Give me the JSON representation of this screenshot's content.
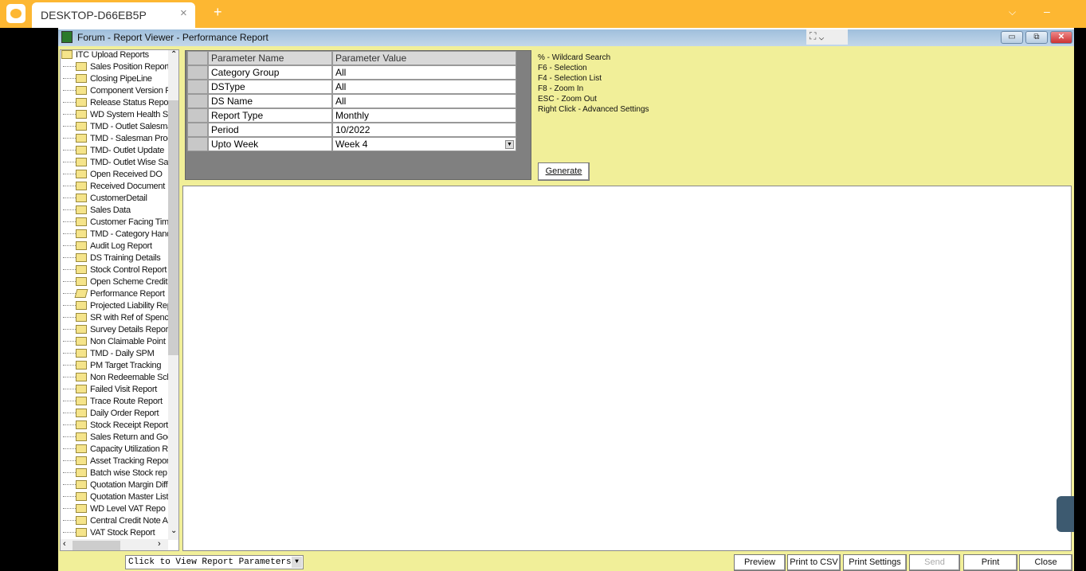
{
  "browser": {
    "tab_title": "DESKTOP-D66EB5P",
    "close": "×",
    "new_tab": "+",
    "chevron": "⌵",
    "minimize": "–"
  },
  "window": {
    "title": "Forum - Report Viewer - Performance Report",
    "min": "▭",
    "restore": "⧉",
    "close": "✕",
    "grip": "⛶ ⌄"
  },
  "tree": {
    "root": "ITC Upload Reports",
    "items": [
      "Sales Position Report",
      "Closing PipeLine",
      "Component Version R",
      "Release Status Repo",
      "WD System Health Sc",
      "TMD - Outlet Salesma",
      "TMD - Salesman Proc",
      "TMD- Outlet Update",
      "TMD- Outlet Wise Sa",
      "Open Received DO",
      "Received Document",
      "CustomerDetail",
      "Sales Data",
      "Customer Facing Time",
      "TMD - Category Hand",
      "Audit Log Report",
      "DS Training Details",
      "Stock Control Report",
      "Open Scheme Credit",
      "Performance Report",
      "Projected Liability Rep",
      "SR with Ref of Spenc",
      "Survey Details Report",
      "Non Claimable Point S",
      "TMD - Daily SPM",
      "PM Target Tracking",
      "Non Redeemable Sch",
      "Failed Visit Report",
      "Trace Route Report",
      "Daily Order Report",
      "Stock Receipt Report",
      "Sales Return and Goo",
      "Capacity Utilization Re",
      "Asset Tracking Repor",
      "Batch wise Stock rep",
      "Quotation Margin Diffe",
      "Quotation Master List",
      "WD Level VAT Repo",
      "Central Credit Note Ac",
      "VAT Stock Report"
    ],
    "selected": "Performance Report"
  },
  "params": {
    "headers": [
      "Parameter Name",
      "Parameter Value"
    ],
    "rows": [
      [
        "Category Group",
        "All"
      ],
      [
        "DSType",
        "All"
      ],
      [
        "DS Name",
        "All"
      ],
      [
        "Report Type",
        "Monthly"
      ],
      [
        "Period",
        "10/2022"
      ],
      [
        "Upto Week",
        "Week 4"
      ]
    ]
  },
  "shortcuts": [
    "% - Wildcard Search",
    "F6 - Selection",
    "F4 - Selection List",
    "F8 - Zoom In",
    "ESC - Zoom Out",
    "Right Click - Advanced Settings"
  ],
  "generate": "Generate",
  "bottom": {
    "select_value": "Click to View Report Parameters",
    "buttons": [
      "Preview",
      "Print to CSV",
      "Print Settings",
      "Send",
      "Print",
      "Close"
    ],
    "disabled": [
      "Send"
    ]
  }
}
